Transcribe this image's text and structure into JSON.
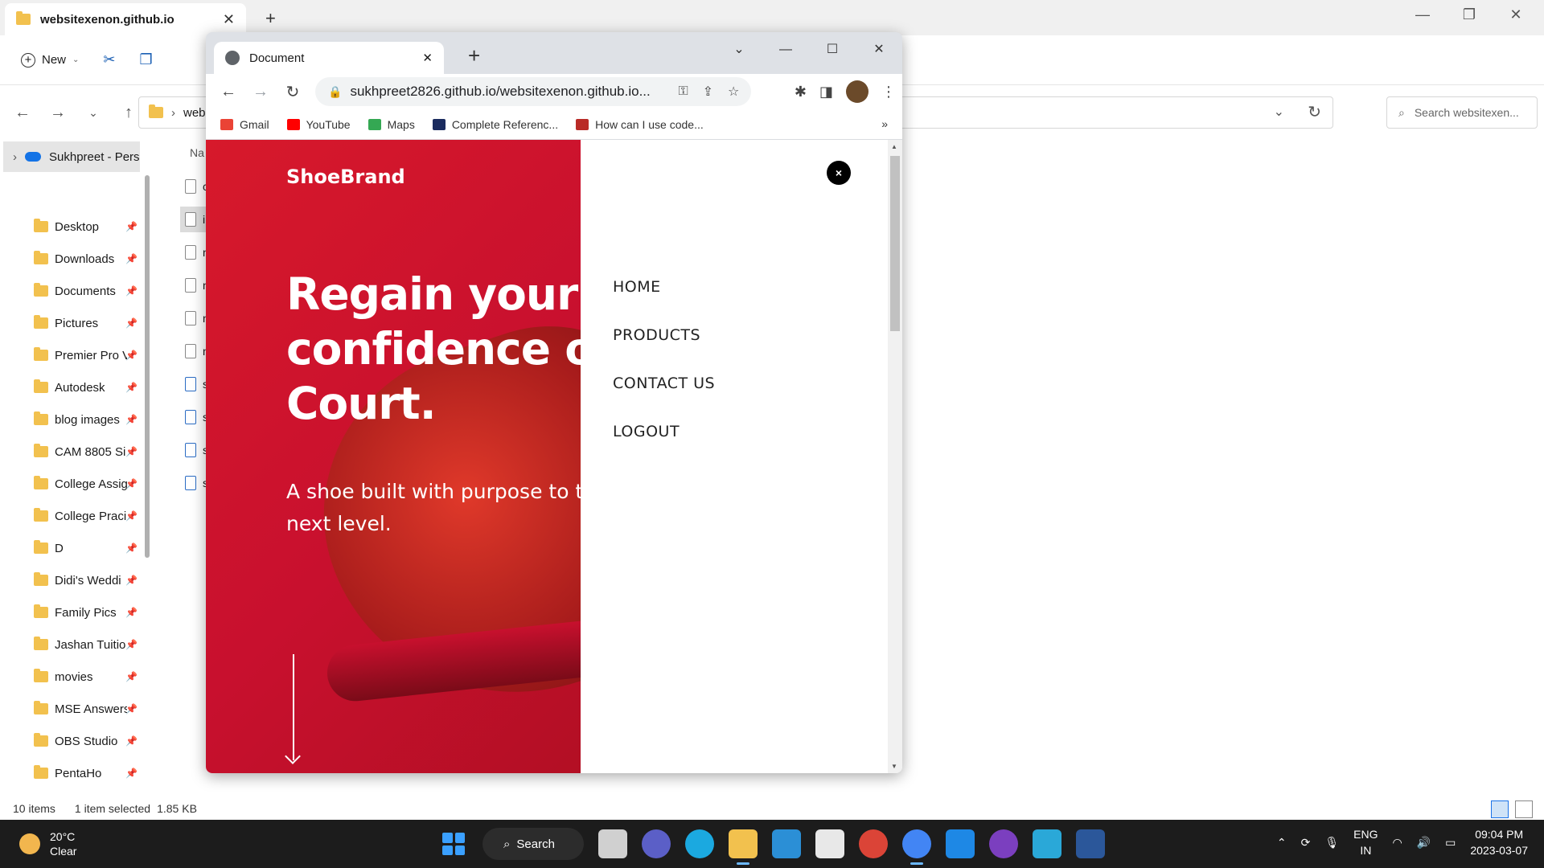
{
  "explorer": {
    "tab_title": "websitexenon.github.io",
    "new_tab_glyph": "+",
    "new_label": "New",
    "address_text": "web",
    "search_placeholder": "Search websitexen...",
    "account_label": "Sukhpreet - Pers",
    "sidebar_items": [
      {
        "label": "Desktop",
        "icon": "desktop-icon"
      },
      {
        "label": "Downloads",
        "icon": "download-icon"
      },
      {
        "label": "Documents",
        "icon": "documents-icon"
      },
      {
        "label": "Pictures",
        "icon": "pictures-icon"
      },
      {
        "label": "Premier Pro V",
        "icon": "folder-icon"
      },
      {
        "label": "Autodesk",
        "icon": "folder-icon"
      },
      {
        "label": "blog images",
        "icon": "folder-icon"
      },
      {
        "label": "CAM 8805 Si",
        "icon": "folder-icon"
      },
      {
        "label": "College Assig",
        "icon": "folder-icon"
      },
      {
        "label": "College Praci",
        "icon": "folder-icon"
      },
      {
        "label": "D",
        "icon": "folder-icon"
      },
      {
        "label": "Didi's Weddi",
        "icon": "folder-icon"
      },
      {
        "label": "Family Pics",
        "icon": "folder-icon"
      },
      {
        "label": "Jashan Tuitio",
        "icon": "folder-icon"
      },
      {
        "label": "movies",
        "icon": "folder-icon"
      },
      {
        "label": "MSE Answers",
        "icon": "folder-icon"
      },
      {
        "label": "OBS Studio",
        "icon": "folder-icon"
      },
      {
        "label": "PentaHo",
        "icon": "folder-icon"
      }
    ],
    "files_header": "Na",
    "files": [
      "c",
      "ir",
      "n",
      "n",
      "n",
      "n",
      "s",
      "s",
      "s",
      "s"
    ],
    "status_count": "10 items",
    "status_selected": "1 item selected",
    "status_size": "1.85 KB"
  },
  "browser": {
    "tab_title": "Document",
    "url": "sukhpreet2826.github.io/websitexenon.github.io...",
    "bookmarks": [
      {
        "label": "Gmail",
        "icon": "gmail-icon",
        "color": "#ea4335"
      },
      {
        "label": "YouTube",
        "icon": "youtube-icon",
        "color": "#ff0000"
      },
      {
        "label": "Maps",
        "icon": "maps-icon",
        "color": "#34a853"
      },
      {
        "label": "Complete Referenc...",
        "icon": "bookmark-n-icon",
        "color": "#1a2b5e"
      },
      {
        "label": "How can I use code...",
        "icon": "quora-icon",
        "color": "#b92b27"
      }
    ],
    "bookmarks_more": "»"
  },
  "page": {
    "brand": "ShoeBrand",
    "headline_lines": [
      "Regain your",
      "confidence o",
      "Court."
    ],
    "subtitle_lines": [
      "A shoe built with purpose to t",
      "next level."
    ],
    "close_glyph": "×",
    "menu": [
      "HOME",
      "PRODUCTS",
      "CONTACT US",
      "LOGOUT"
    ],
    "hero_color": "#c8102e"
  },
  "taskbar": {
    "temp": "20°C",
    "condition": "Clear",
    "search_label": "Search",
    "lang_top": "ENG",
    "lang_bottom": "IN",
    "time": "09:04 PM",
    "date": "2023-03-07"
  }
}
